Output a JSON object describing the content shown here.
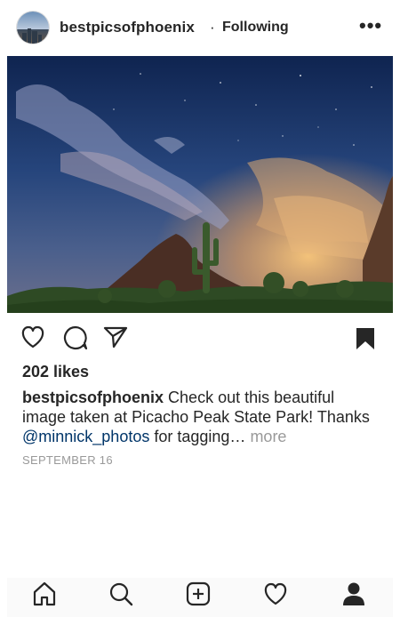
{
  "post": {
    "username": "bestpicsofphoenix",
    "separator": "·",
    "following_label": "Following",
    "options_icon": "more-horizontal-icon",
    "likes": "202 likes",
    "caption": {
      "username": "bestpicsofphoenix",
      "text_before": "Check out this beautiful image taken at Picacho Peak State Park! Thanks",
      "mention": "@minnick_photos",
      "text_after": "for tagging…",
      "more_label": "more"
    },
    "date": "SEPTEMBER 16"
  },
  "actions": {
    "like_icon": "heart-icon",
    "comment_icon": "comment-icon",
    "share_icon": "send-icon",
    "save_icon": "bookmark-filled-icon"
  },
  "tabbar": {
    "items": [
      "home-icon",
      "search-icon",
      "new-post-icon",
      "activity-heart-icon",
      "profile-icon"
    ]
  }
}
